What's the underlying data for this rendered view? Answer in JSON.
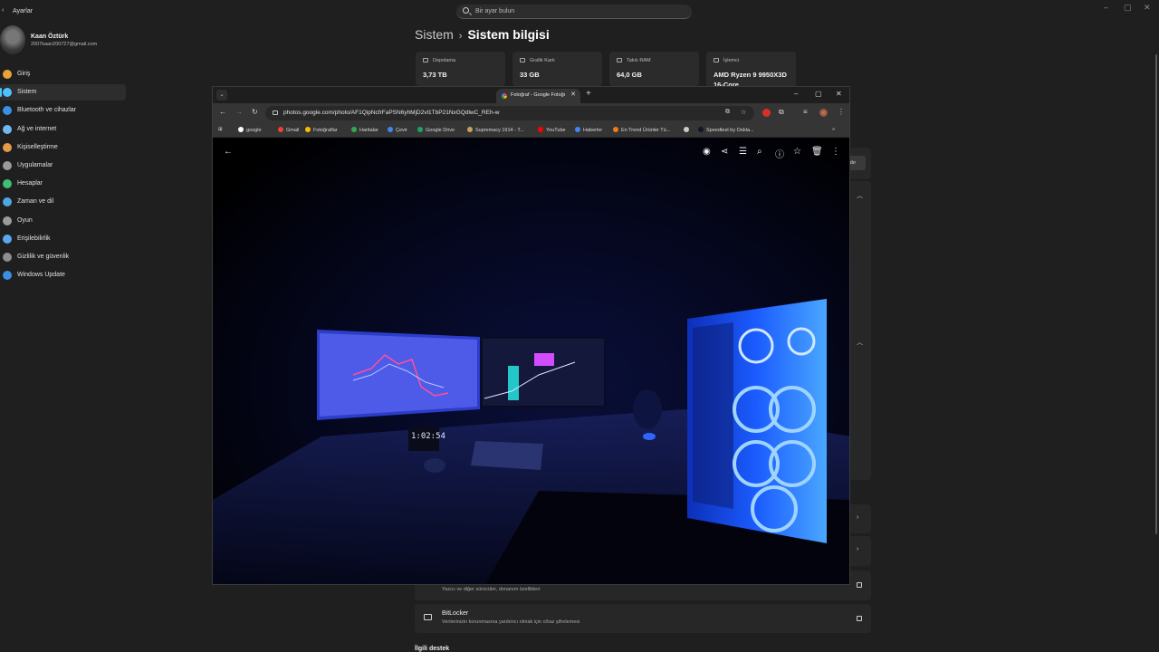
{
  "settings": {
    "app_title": "Ayarlar",
    "search_placeholder": "Bir ayar bulun",
    "user": {
      "name": "Kaan Öztürk",
      "email": "2007kaan200727@gmail.com"
    },
    "nav": [
      {
        "label": "Giriş",
        "icon": "home-icon",
        "color": "#e8a33a"
      },
      {
        "label": "Sistem",
        "icon": "system-icon",
        "color": "#4cc2ff",
        "active": true
      },
      {
        "label": "Bluetooth ve cihazlar",
        "icon": "bluetooth-icon",
        "color": "#3a8ee6"
      },
      {
        "label": "Ağ ve internet",
        "icon": "network-icon",
        "color": "#6fb7ef"
      },
      {
        "label": "Kişiselleştirme",
        "icon": "brush-icon",
        "color": "#e59b48"
      },
      {
        "label": "Uygulamalar",
        "icon": "apps-icon",
        "color": "#9a9a9a"
      },
      {
        "label": "Hesaplar",
        "icon": "account-icon",
        "color": "#3fbf75"
      },
      {
        "label": "Zaman ve dil",
        "icon": "clock-globe-icon",
        "color": "#4fa7e0"
      },
      {
        "label": "Oyun",
        "icon": "gamepad-icon",
        "color": "#9b9b9b"
      },
      {
        "label": "Erişilebilirlik",
        "icon": "accessibility-icon",
        "color": "#5aa7f0"
      },
      {
        "label": "Gizlilik ve güvenlik",
        "icon": "shield-icon",
        "color": "#8e8e8e"
      },
      {
        "label": "Windows Update",
        "icon": "update-icon",
        "color": "#3a8ee6"
      }
    ],
    "breadcrumb": {
      "parent": "Sistem",
      "current": "Sistem bilgisi"
    },
    "cards": [
      {
        "label": "Depolama",
        "value": "3,73 TB"
      },
      {
        "label": "Grafik Kartı",
        "value": "33 GB"
      },
      {
        "label": "Takılı RAM",
        "value": "64,0 GB"
      },
      {
        "label": "İşlemci",
        "value": "AMD Ryzen 9 9950X3D 16-Core"
      }
    ],
    "rename_button_partial": "dır",
    "device_manager": {
      "subtitle": "Yazıcı ve diğer sürücüler, donanım özellikleri"
    },
    "bitlocker": {
      "title": "BitLocker",
      "subtitle": "Verilerinizin korunmasına yardımcı olmak için cihaz şifrelemesi"
    },
    "related_support": "İlgili destek"
  },
  "chrome": {
    "tab_title": "Fotoğraf - Google Fotoğraflar",
    "url": "photos.google.com/photo/AF1QipNcfrFaPSN6yhMjD2vl1TbP21NxGQdlwC_REh-w",
    "bookmarks": [
      {
        "label": "google",
        "color": "#ffffff"
      },
      {
        "label": "Gmail",
        "color": "#ea4335"
      },
      {
        "label": "Fotoğraflar",
        "color": "#fbbc04"
      },
      {
        "label": "Haritalar",
        "color": "#34a853"
      },
      {
        "label": "Çevir",
        "color": "#4285f4"
      },
      {
        "label": "Google Drive",
        "color": "#1fa463"
      },
      {
        "label": "Supremacy 1914 - T...",
        "color": "#c8a060"
      },
      {
        "label": "YouTube",
        "color": "#ff0000"
      },
      {
        "label": "Haberler",
        "color": "#4285f4"
      },
      {
        "label": "En Trend Ürünler Tü...",
        "color": "#f27a1a"
      },
      {
        "label": "",
        "color": "#cccccc"
      },
      {
        "label": "Speedtest by Ookla...",
        "color": "#141526"
      }
    ],
    "photo_clock": "1:02:54"
  }
}
